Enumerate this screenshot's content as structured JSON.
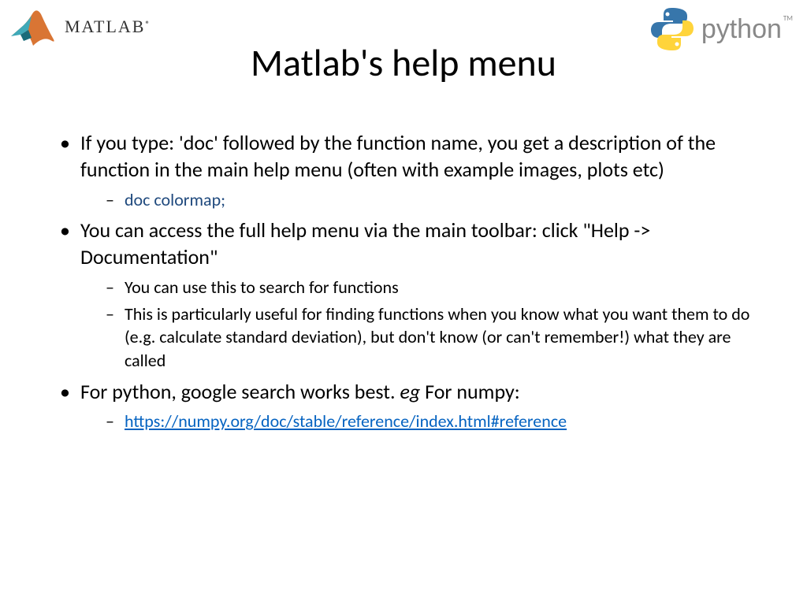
{
  "header": {
    "matlab_label": "MATLAB",
    "python_label": "python",
    "tm": "TM"
  },
  "title": "Matlab's help menu",
  "bullets": {
    "b1": "If you type: 'doc' followed by the function name, you get a description of the function in the main help menu (often with example images, plots etc)",
    "b1_sub1": "doc colormap;",
    "b2": "You can access the full help menu via the main toolbar: click \"Help -> Documentation\"",
    "b2_sub1": "You can use this to search for functions",
    "b2_sub2": "This is particularly useful for finding functions when you know what you want them to do (e.g. calculate standard deviation), but don't know (or can't remember!) what they are called",
    "b3_pre": "For python, google search works best. ",
    "b3_eg": "eg",
    "b3_post": " For numpy:",
    "b3_sub1": "https://numpy.org/doc/stable/reference/index.html#reference"
  }
}
